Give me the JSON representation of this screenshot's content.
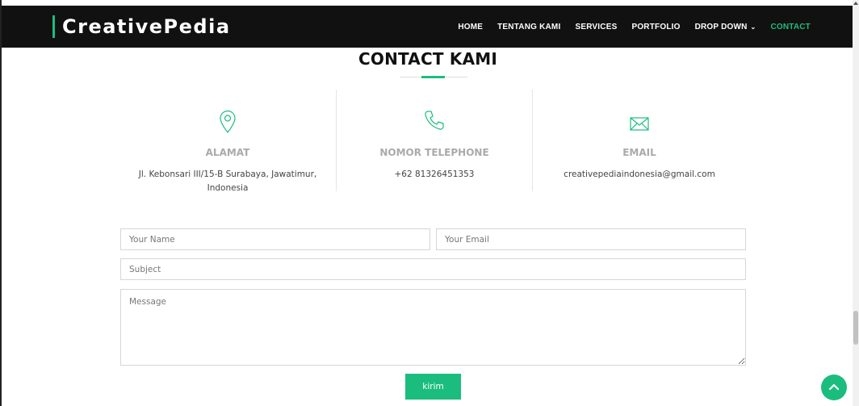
{
  "brand": {
    "name": "CreativePedia"
  },
  "nav": {
    "items": [
      {
        "label": "HOME",
        "active": false
      },
      {
        "label": "TENTANG KAMI",
        "active": false
      },
      {
        "label": "SERVICES",
        "active": false
      },
      {
        "label": "PORTFOLIO",
        "active": false
      },
      {
        "label": "DROP DOWN",
        "active": false,
        "dropdown": true
      },
      {
        "label": "CONTACT",
        "active": true
      }
    ]
  },
  "section": {
    "title": "CONTACT KAMI"
  },
  "info": [
    {
      "icon": "map-pin-icon",
      "label": "ALAMAT",
      "value": "Jl. Kebonsari III/15-B Surabaya, Jawatimur, Indonesia"
    },
    {
      "icon": "phone-icon",
      "label": "NOMOR TELEPHONE",
      "value": "+62 81326451353"
    },
    {
      "icon": "envelope-icon",
      "label": "EMAIL",
      "value": "creativepediaindonesia@gmail.com"
    }
  ],
  "form": {
    "name_placeholder": "Your Name",
    "email_placeholder": "Your Email",
    "subject_placeholder": "Subject",
    "message_placeholder": "Message",
    "submit_label": "kirim"
  },
  "colors": {
    "accent": "#1bbd7e",
    "navbar": "#111111",
    "label": "#aaaaaa"
  }
}
